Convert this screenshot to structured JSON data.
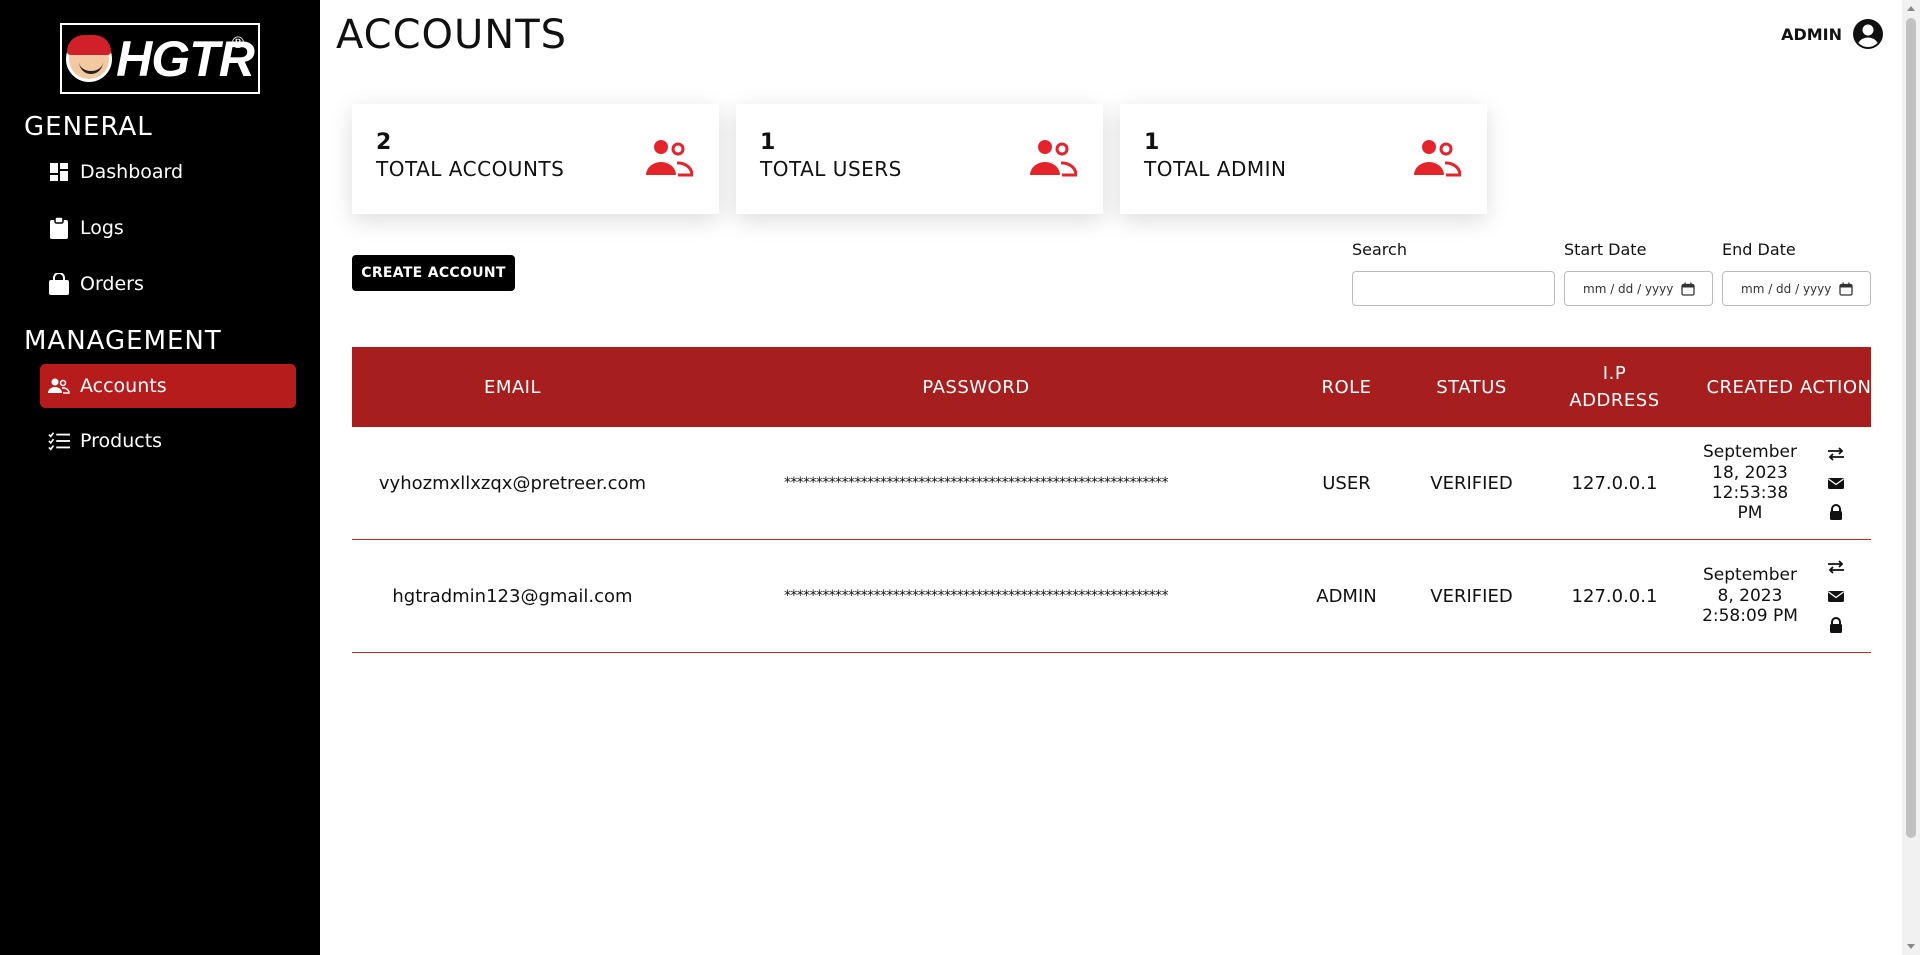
{
  "brand": {
    "logo_text": "HGTR",
    "registered": "®"
  },
  "sidebar": {
    "sections": [
      {
        "title": "GENERAL"
      },
      {
        "title": "MANAGEMENT"
      }
    ],
    "items": [
      {
        "label": "Dashboard",
        "icon": "dashboard-icon"
      },
      {
        "label": "Logs",
        "icon": "clipboard-icon"
      },
      {
        "label": "Orders",
        "icon": "shopping-bag-icon"
      },
      {
        "label": "Accounts",
        "icon": "users-icon",
        "active": true
      },
      {
        "label": "Products",
        "icon": "checklist-icon"
      }
    ]
  },
  "header": {
    "title": "ACCOUNTS",
    "user": "ADMIN",
    "user_icon": "user-circle-icon"
  },
  "cards": [
    {
      "value": "2",
      "label": "TOTAL ACCOUNTS",
      "icon": "users-icon"
    },
    {
      "value": "1",
      "label": "TOTAL USERS",
      "icon": "users-icon"
    },
    {
      "value": "1",
      "label": "TOTAL ADMIN",
      "icon": "users-icon"
    }
  ],
  "toolbar": {
    "create_label": "CREATE ACCOUNT"
  },
  "filters": {
    "search_label": "Search",
    "search_value": "",
    "start_label": "Start Date",
    "start_placeholder": "mm / dd / yyyy",
    "end_label": "End Date",
    "end_placeholder": "mm / dd / yyyy"
  },
  "table": {
    "headers": [
      "EMAIL",
      "PASSWORD",
      "ROLE",
      "STATUS",
      "I.P ADDRESS",
      "CREATED",
      "ACTION"
    ],
    "rows": [
      {
        "email": "vyhozmxllxzqx@pretreer.com",
        "password": "************************************************************",
        "role": "USER",
        "status": "VERIFIED",
        "ip": "127.0.0.1",
        "created": [
          "September",
          "18, 2023",
          "12:53:38 PM"
        ]
      },
      {
        "email": "hgtradmin123@gmail.com",
        "password": "************************************************************",
        "role": "ADMIN",
        "status": "VERIFIED",
        "ip": "127.0.0.1",
        "created": [
          "September",
          "8, 2023",
          "2:58:09 PM"
        ]
      }
    ],
    "action_icons": [
      "switch-role-icon",
      "envelope-icon",
      "lock-icon"
    ]
  },
  "colors": {
    "accent": "#a71e1e",
    "active_nav": "#b71c1c",
    "icon_red": "#e3242b",
    "sidebar_bg": "#000000"
  }
}
